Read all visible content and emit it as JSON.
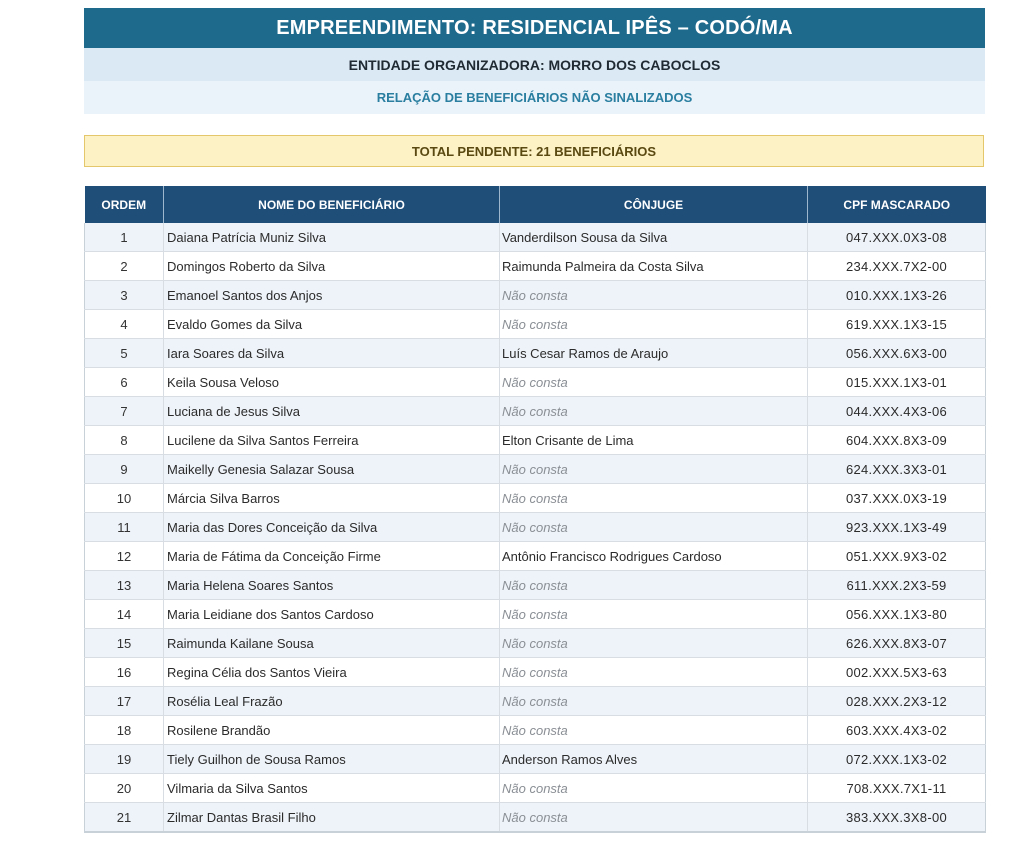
{
  "header": {
    "title": "EMPREENDIMENTO: RESIDENCIAL IPÊS – CODÓ/MA",
    "entity": "ENTIDADE ORGANIZADORA: MORRO DOS CABOCLOS",
    "subtitle": "RELAÇÃO DE BENEFICIÁRIOS NÃO SINALIZADOS"
  },
  "total": "TOTAL PENDENTE: 21 BENEFICIÁRIOS",
  "table": {
    "columns": [
      "ORDEM",
      "NOME DO BENEFICIÁRIO",
      "CÔNJUGE",
      "CPF MASCARADO"
    ],
    "rows": [
      {
        "ordem": "1",
        "nome": "Daiana Patrícia Muniz Silva",
        "conjuge": "Vanderdilson Sousa da Silva",
        "cpf": "047.XXX.0X3-08"
      },
      {
        "ordem": "2",
        "nome": "Domingos Roberto da Silva",
        "conjuge": "Raimunda Palmeira da Costa Silva",
        "cpf": "234.XXX.7X2-00"
      },
      {
        "ordem": "3",
        "nome": "Emanoel Santos dos Anjos",
        "conjuge": "Não consta",
        "cpf": "010.XXX.1X3-26"
      },
      {
        "ordem": "4",
        "nome": "Evaldo Gomes da Silva",
        "conjuge": "Não consta",
        "cpf": "619.XXX.1X3-15"
      },
      {
        "ordem": "5",
        "nome": "Iara Soares da Silva",
        "conjuge": "Luís Cesar Ramos de Araujo",
        "cpf": "056.XXX.6X3-00"
      },
      {
        "ordem": "6",
        "nome": "Keila Sousa Veloso",
        "conjuge": "Não consta",
        "cpf": "015.XXX.1X3-01"
      },
      {
        "ordem": "7",
        "nome": "Luciana de Jesus Silva",
        "conjuge": "Não consta",
        "cpf": "044.XXX.4X3-06"
      },
      {
        "ordem": "8",
        "nome": "Lucilene da Silva Santos Ferreira",
        "conjuge": "Elton Crisante de Lima",
        "cpf": "604.XXX.8X3-09"
      },
      {
        "ordem": "9",
        "nome": "Maikelly Genesia Salazar Sousa",
        "conjuge": "Não consta",
        "cpf": "624.XXX.3X3-01"
      },
      {
        "ordem": "10",
        "nome": "Márcia Silva Barros",
        "conjuge": "Não consta",
        "cpf": "037.XXX.0X3-19"
      },
      {
        "ordem": "11",
        "nome": "Maria das Dores Conceição da Silva",
        "conjuge": "Não consta",
        "cpf": "923.XXX.1X3-49"
      },
      {
        "ordem": "12",
        "nome": "Maria de Fátima da Conceição Firme",
        "conjuge": "Antônio Francisco Rodrigues Cardoso",
        "cpf": "051.XXX.9X3-02"
      },
      {
        "ordem": "13",
        "nome": "Maria Helena Soares Santos",
        "conjuge": "Não consta",
        "cpf": "611.XXX.2X3-59"
      },
      {
        "ordem": "14",
        "nome": "Maria Leidiane dos Santos Cardoso",
        "conjuge": "Não consta",
        "cpf": "056.XXX.1X3-80"
      },
      {
        "ordem": "15",
        "nome": "Raimunda Kailane Sousa",
        "conjuge": "Não consta",
        "cpf": "626.XXX.8X3-07"
      },
      {
        "ordem": "16",
        "nome": "Regina Célia dos Santos Vieira",
        "conjuge": "Não consta",
        "cpf": "002.XXX.5X3-63"
      },
      {
        "ordem": "17",
        "nome": "Rosélia Leal Frazão",
        "conjuge": "Não consta",
        "cpf": "028.XXX.2X3-12"
      },
      {
        "ordem": "18",
        "nome": "Rosilene Brandão",
        "conjuge": "Não consta",
        "cpf": "603.XXX.4X3-02"
      },
      {
        "ordem": "19",
        "nome": "Tiely Guilhon de Sousa Ramos",
        "conjuge": "Anderson Ramos Alves",
        "cpf": "072.XXX.1X3-02"
      },
      {
        "ordem": "20",
        "nome": "Vilmaria da Silva Santos",
        "conjuge": "Não consta",
        "cpf": "708.XXX.7X1-11"
      },
      {
        "ordem": "21",
        "nome": "Zilmar Dantas Brasil Filho",
        "conjuge": "Não consta",
        "cpf": "383.XXX.3X8-00"
      }
    ]
  }
}
